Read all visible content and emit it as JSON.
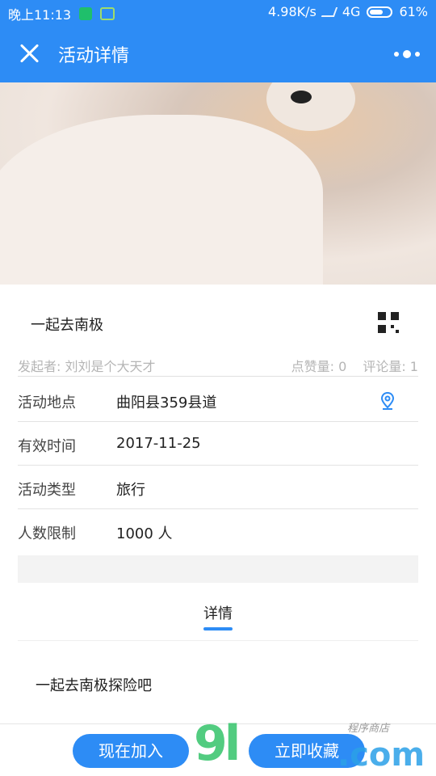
{
  "status_bar": {
    "time": "晚上11:13",
    "speed": "4.98K/s",
    "network": "4G",
    "battery": "61%"
  },
  "header": {
    "title": "活动详情",
    "close_icon": "close-icon",
    "more_icon": "more-dots-icon",
    "color": "#2d8cf5"
  },
  "activity": {
    "title": "一起去南极",
    "sponsor": "发起者: 刘刘是个大天才",
    "likes": "点赞量: 0",
    "comments": "评论量: 1"
  },
  "info": {
    "location_label": "活动地点",
    "location_value": "曲阳县359县道",
    "time_label": "有效时间",
    "time_value": "2017-11-25",
    "type_label": "活动类型",
    "type_value": "旅行",
    "limit_label": "人数限制",
    "limit_value": "1000 人"
  },
  "detail": {
    "tab_label": "详情",
    "description": "一起去南极探险吧"
  },
  "actions": {
    "join": "现在加入",
    "favorite": "立即收藏"
  },
  "watermark": {
    "brand": "9l",
    "domain": ".com",
    "tagline": "程序商店"
  }
}
